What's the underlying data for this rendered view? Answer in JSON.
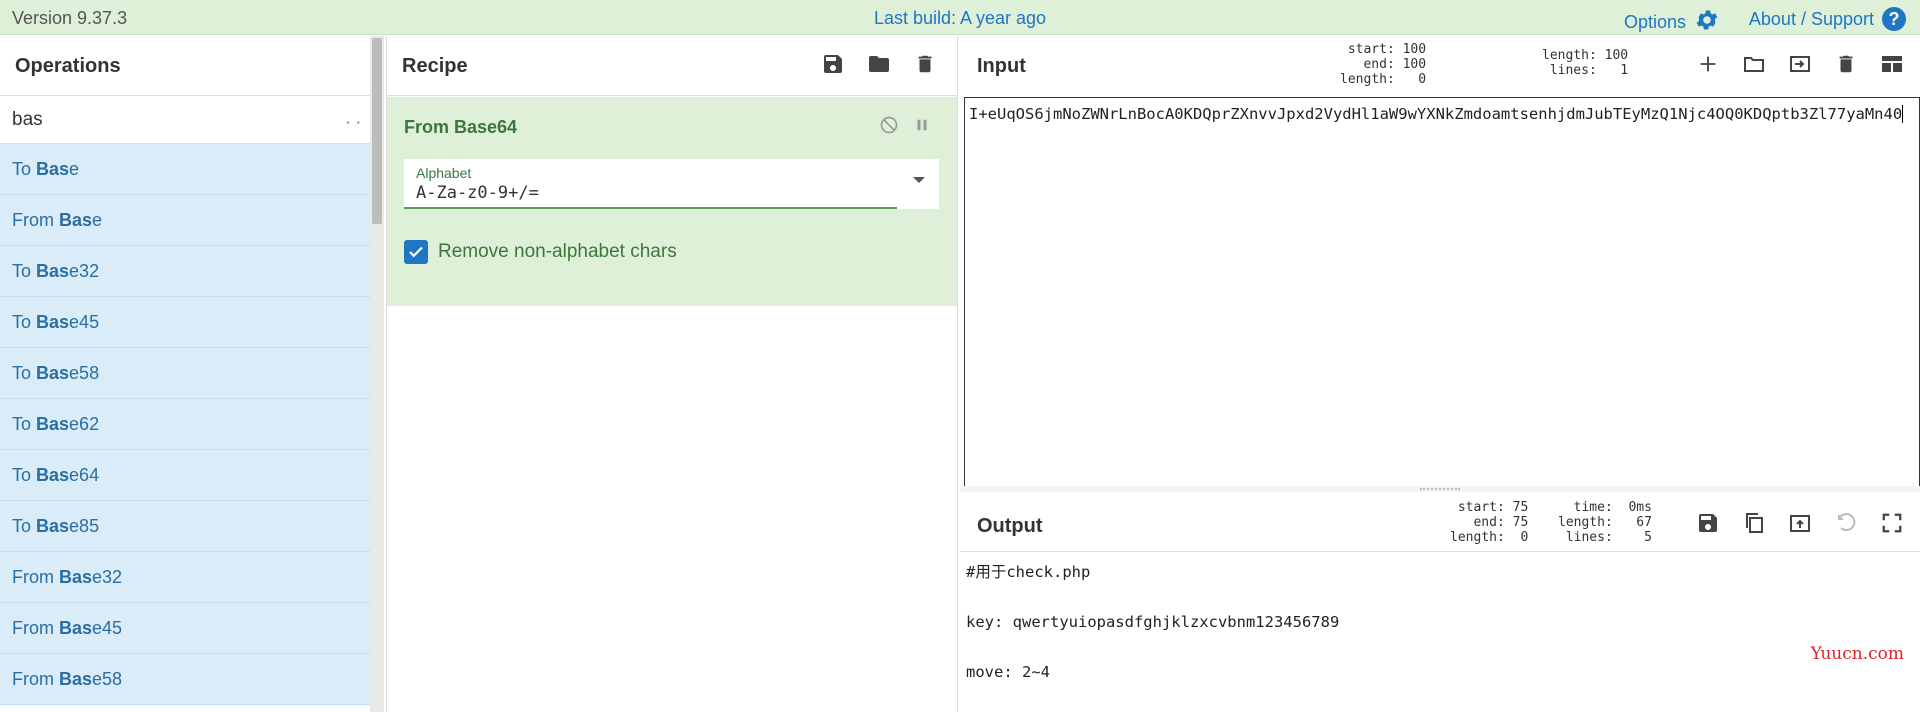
{
  "banner": {
    "version": "Version 9.37.3",
    "build": "Last build: A year ago",
    "options": "Options",
    "about": "About / Support"
  },
  "operations": {
    "title": "Operations",
    "search_value": "bas",
    "items": [
      {
        "pre": "To ",
        "match": "Bas",
        "post": "e"
      },
      {
        "pre": "From ",
        "match": "Bas",
        "post": "e"
      },
      {
        "pre": "To ",
        "match": "Bas",
        "post": "e32"
      },
      {
        "pre": "To ",
        "match": "Bas",
        "post": "e45"
      },
      {
        "pre": "To ",
        "match": "Bas",
        "post": "e58"
      },
      {
        "pre": "To ",
        "match": "Bas",
        "post": "e62"
      },
      {
        "pre": "To ",
        "match": "Bas",
        "post": "e64"
      },
      {
        "pre": "To ",
        "match": "Bas",
        "post": "e85"
      },
      {
        "pre": "From ",
        "match": "Bas",
        "post": "e32"
      },
      {
        "pre": "From ",
        "match": "Bas",
        "post": "e45"
      },
      {
        "pre": "From ",
        "match": "Bas",
        "post": "e58"
      }
    ]
  },
  "recipe": {
    "title": "Recipe",
    "operation": {
      "name": "From Base64",
      "alphabet_label": "Alphabet",
      "alphabet_value": "A-Za-z0-9+/=",
      "remove_label": "Remove non-alphabet chars",
      "remove_checked": true
    }
  },
  "input": {
    "title": "Input",
    "stats_left": "start: 100\n  end: 100\nlength:   0",
    "stats_right": "length: 100\n lines:   1",
    "text": "I+eUqOS6jmNoZWNrLnBocA0KDQprZXnvvJpxd2VydHl1aW9wYXNkZmdoamtsenhjdmJubTEyMzQ1Njc4OQ0KDQptb3Zl77yaMn40"
  },
  "output": {
    "title": "Output",
    "stats_left": "start: 75\n  end: 75\nlength:  0",
    "stats_right": "  time:  0ms\nlength:   67\n lines:    5",
    "text": "#用于check.php\n\nkey: qwertyuiopasdfghjklzxcvbnm123456789\n\nmove: 2~4"
  },
  "watermark": "Yuucn.com"
}
